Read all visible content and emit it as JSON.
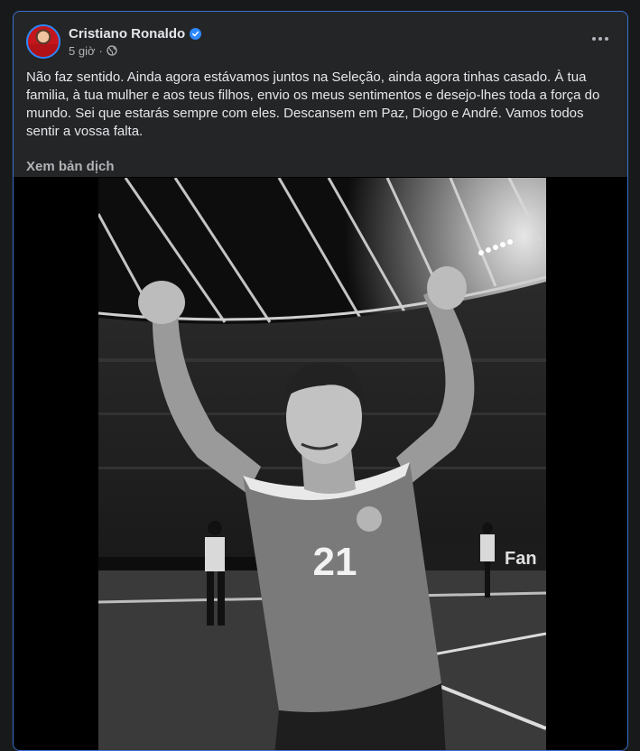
{
  "post": {
    "author": "Cristiano Ronaldo",
    "verified": true,
    "time": "5 giờ",
    "privacy_icon": "globe-icon",
    "text": "Não faz sentido. Ainda agora estávamos juntos na Seleção, ainda agora tinhas casado. À tua familia, à tua mulher e aos teus filhos, envio os meus sentimentos e desejo-lhes toda a força do mundo. Sei que estarás sempre com eles. Descansem em Paz, Diogo e André. Vamos todos sentir a vossa falta.",
    "translate_label": "Xem bản dịch",
    "photo": {
      "jersey_number": "21",
      "board_text": "Fan"
    }
  },
  "colors": {
    "background": "#18191a",
    "card": "#242526",
    "text_primary": "#e4e6eb",
    "text_secondary": "#b0b3b8",
    "accent": "#2d88ff"
  }
}
